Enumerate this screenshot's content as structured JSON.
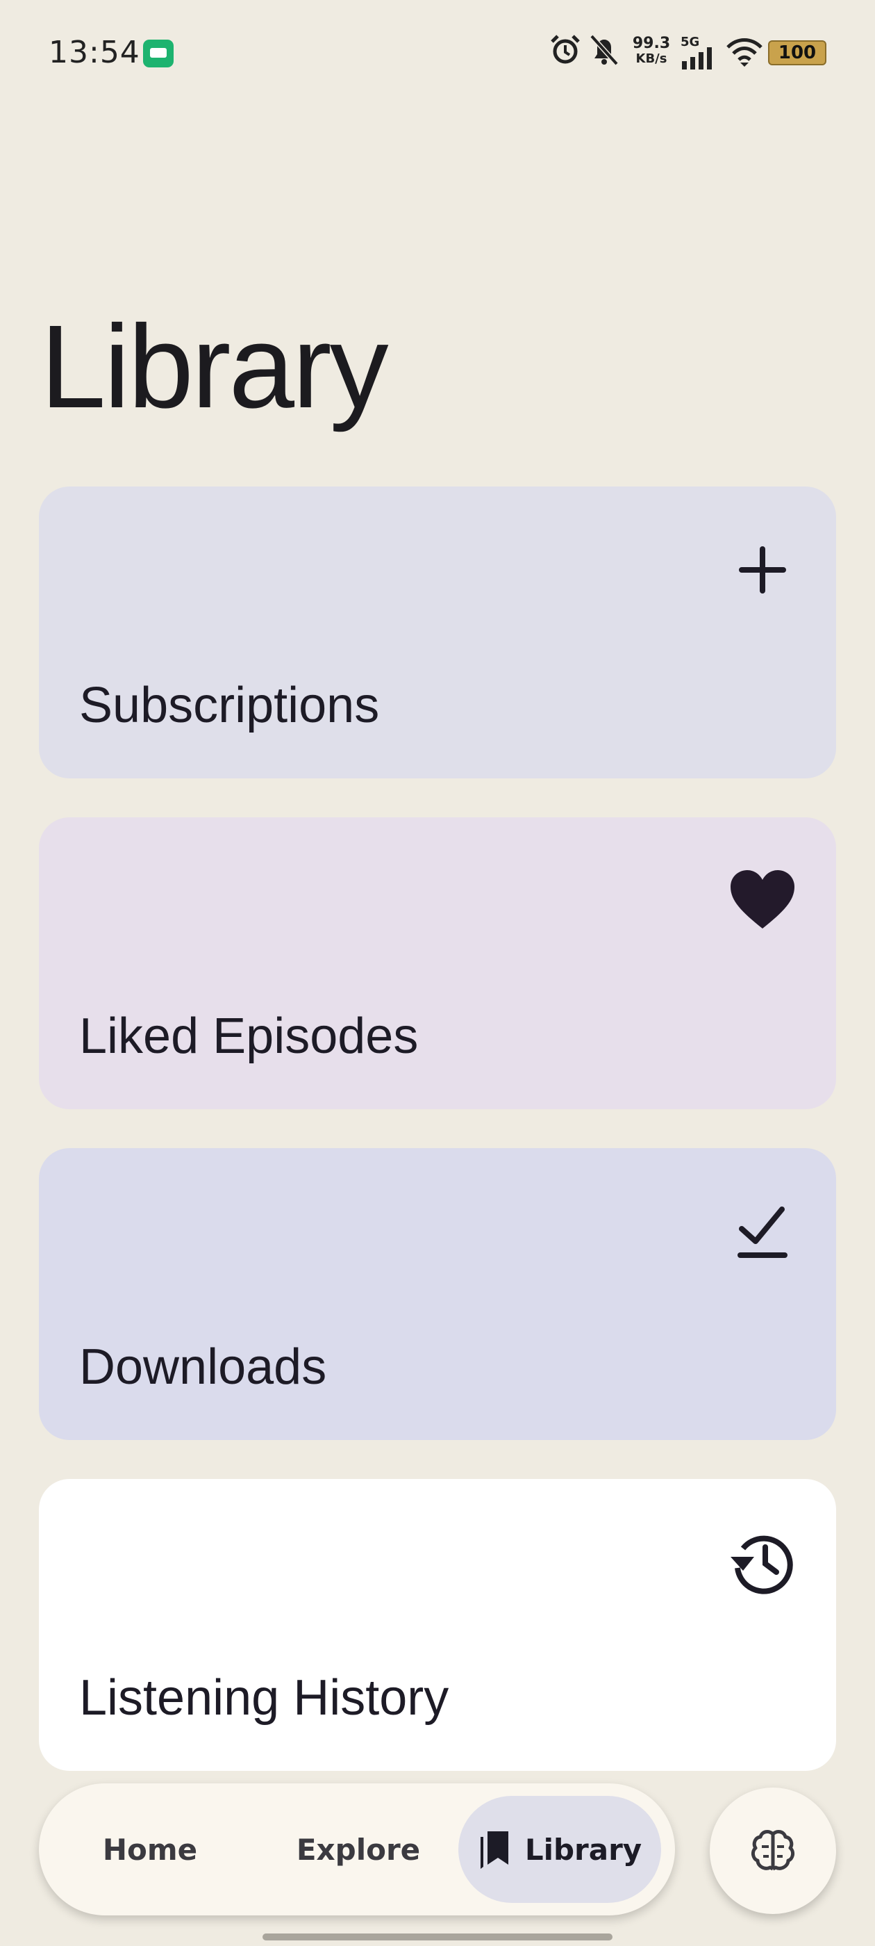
{
  "status_bar": {
    "time": "13:54",
    "net_speed_value": "99.3",
    "net_speed_unit": "KB/s",
    "signal_label": "5G",
    "battery": "100"
  },
  "page": {
    "title": "Library"
  },
  "cards": [
    {
      "label": "Subscriptions",
      "icon": "plus-icon",
      "color": "#dfdfea"
    },
    {
      "label": "Liked Episodes",
      "icon": "heart-icon",
      "color": "#e7dfeb"
    },
    {
      "label": "Downloads",
      "icon": "download-done-icon",
      "color": "#dadbec"
    },
    {
      "label": "Listening History",
      "icon": "history-icon",
      "color": "#ffffff"
    }
  ],
  "nav": {
    "home": "Home",
    "explore": "Explore",
    "library": "Library",
    "active": "library"
  },
  "fab": {
    "icon": "brain-icon"
  }
}
